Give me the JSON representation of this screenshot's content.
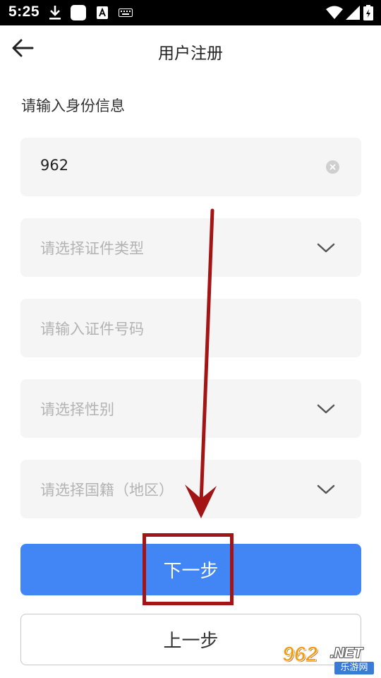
{
  "status_bar": {
    "time": "5:25",
    "icons": [
      "download-icon",
      "app-square-icon",
      "a-badge-icon",
      "keyboard-icon",
      "wifi-icon",
      "signal-icon",
      "battery-icon"
    ]
  },
  "nav": {
    "title": "用户注册",
    "back_icon": "arrow-left-icon"
  },
  "section_label": "请输入身份信息",
  "fields": {
    "name": {
      "value": "962"
    },
    "id_type": {
      "placeholder": "请选择证件类型"
    },
    "id_number": {
      "placeholder": "请输入证件号码"
    },
    "gender": {
      "placeholder": "请选择性别"
    },
    "nationality": {
      "placeholder": "请选择国籍（地区）"
    }
  },
  "buttons": {
    "next": "下一步",
    "previous": "上一步"
  },
  "annotation": {
    "color": "#a31515"
  },
  "watermark": {
    "logo": "962",
    "domain": ".NET",
    "site_name": "乐游网"
  },
  "colors": {
    "primary": "#4285f4",
    "field_bg": "#f5f5f5",
    "placeholder": "#b3b3b3"
  }
}
